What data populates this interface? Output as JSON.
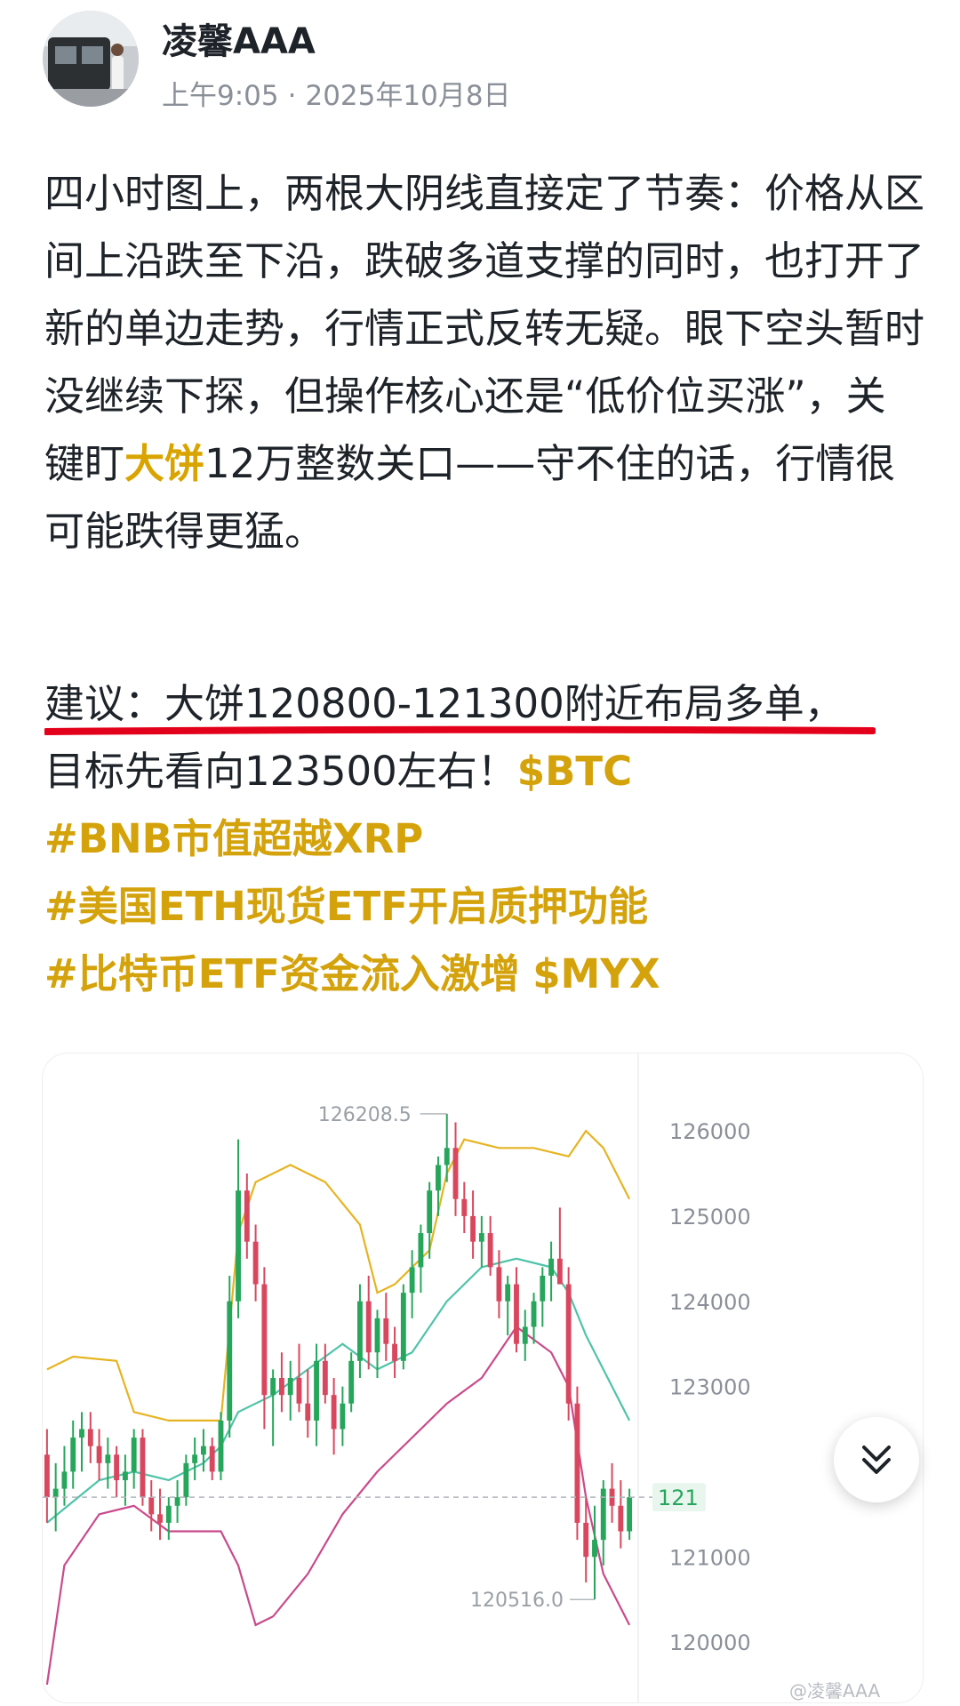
{
  "post": {
    "author": "凌馨AAA",
    "time": "上午9:05",
    "dot": "·",
    "date": "2025年10月8日",
    "para1_a": "四小时图上，两根大阴线直接定了节奏：价格从区间上沿跌至下沿，跌破多道支撑的同时，也打开了新的单边走势，行情正式反转无疑。眼下空头暂时没继续下探，但操作核心还是“低价位买涨”，关键盯",
    "para1_hl": "大饼",
    "para1_b": "12万整数关口——守不住的话，行情很可能跌得更猛。",
    "para2_line1": "建议：大饼120800-121300附近布局多单，",
    "para2_line2": "目标先看向123500左右！",
    "tag_btc": "$BTC",
    "tag1": "#BNB市值超越XRP",
    "tag2": "#美国ETH现货ETF开启质押功能",
    "tag3": "#比特币ETF资金流入激增",
    "tag_myx": "$MYX"
  },
  "chart_data": {
    "type": "candlestick",
    "y_axis_ticks": [
      126000,
      125000,
      124000,
      123000,
      121000,
      120000
    ],
    "ylim": [
      119500,
      126700
    ],
    "high_label": "126208.5",
    "low_label": "120516.0",
    "last_price_label": "121",
    "watermark": "@凌馨AAA",
    "series": [
      {
        "role": "upper-band",
        "color": "#e6b422"
      },
      {
        "role": "middle-band",
        "color": "#4fc3a8"
      },
      {
        "role": "lower-band",
        "color": "#c94a8c"
      }
    ],
    "colors": {
      "up": "#26a65b",
      "down": "#d9475e",
      "underline": "#e3001b",
      "tag": "#d4a20b"
    },
    "candles": [
      [
        122200,
        122500,
        121400,
        121700
      ],
      [
        121700,
        122100,
        121300,
        121800
      ],
      [
        121800,
        122300,
        121600,
        122000
      ],
      [
        122000,
        122600,
        121800,
        122400
      ],
      [
        122400,
        122700,
        122000,
        122500
      ],
      [
        122500,
        122700,
        122100,
        122300
      ],
      [
        122300,
        122500,
        121900,
        122100
      ],
      [
        122100,
        122400,
        121800,
        122200
      ],
      [
        122200,
        122300,
        121700,
        121900
      ],
      [
        121900,
        122200,
        121600,
        122000
      ],
      [
        122000,
        122500,
        121800,
        122400
      ],
      [
        122400,
        122500,
        121600,
        121700
      ],
      [
        121700,
        121900,
        121300,
        121500
      ],
      [
        121500,
        121800,
        121200,
        121400
      ],
      [
        121400,
        121700,
        121200,
        121600
      ],
      [
        121600,
        121900,
        121400,
        121700
      ],
      [
        121700,
        122200,
        121600,
        122100
      ],
      [
        122100,
        122400,
        121900,
        122200
      ],
      [
        122200,
        122500,
        122000,
        122300
      ],
      [
        122300,
        122400,
        121900,
        122000
      ],
      [
        122000,
        122700,
        121900,
        122600
      ],
      [
        122600,
        124300,
        122400,
        124000
      ],
      [
        124000,
        125900,
        123800,
        125300
      ],
      [
        125300,
        125500,
        124500,
        124700
      ],
      [
        124700,
        124900,
        124000,
        124200
      ],
      [
        124200,
        124400,
        122500,
        122900
      ],
      [
        122900,
        123200,
        122300,
        123100
      ],
      [
        123100,
        123400,
        122700,
        122900
      ],
      [
        122900,
        123300,
        122600,
        123100
      ],
      [
        123100,
        123500,
        122700,
        122800
      ],
      [
        122800,
        123200,
        122400,
        122600
      ],
      [
        122600,
        123500,
        122300,
        123300
      ],
      [
        123300,
        123500,
        122800,
        122900
      ],
      [
        122900,
        123100,
        122200,
        122500
      ],
      [
        122500,
        123000,
        122300,
        122800
      ],
      [
        122800,
        123400,
        122700,
        123300
      ],
      [
        123300,
        124200,
        123100,
        124000
      ],
      [
        124000,
        124300,
        123200,
        123400
      ],
      [
        123400,
        123900,
        123100,
        123800
      ],
      [
        123800,
        124100,
        123300,
        123500
      ],
      [
        123500,
        123700,
        123100,
        123300
      ],
      [
        123300,
        124200,
        123200,
        124100
      ],
      [
        124100,
        124600,
        123800,
        124400
      ],
      [
        124400,
        124900,
        124100,
        124800
      ],
      [
        124800,
        125400,
        124500,
        125300
      ],
      [
        125300,
        125700,
        125000,
        125600
      ],
      [
        125600,
        126200,
        125400,
        125800
      ],
      [
        125800,
        126100,
        125000,
        125200
      ],
      [
        125200,
        125400,
        124800,
        125000
      ],
      [
        125000,
        125300,
        124500,
        124700
      ],
      [
        124700,
        125000,
        124400,
        124800
      ],
      [
        124800,
        125000,
        124300,
        124400
      ],
      [
        124400,
        124600,
        123800,
        124000
      ],
      [
        124000,
        124300,
        123600,
        124200
      ],
      [
        124200,
        124400,
        123400,
        123500
      ],
      [
        123500,
        123900,
        123300,
        123700
      ],
      [
        123700,
        124100,
        123500,
        124000
      ],
      [
        124000,
        124400,
        123700,
        124300
      ],
      [
        124300,
        124700,
        124000,
        124500
      ],
      [
        124500,
        125100,
        124300,
        124200
      ],
      [
        124200,
        124400,
        122600,
        122800
      ],
      [
        122800,
        123000,
        121200,
        121400
      ],
      [
        121400,
        121700,
        120700,
        121000
      ],
      [
        121000,
        121600,
        120500,
        121200
      ],
      [
        121200,
        121900,
        120900,
        121800
      ],
      [
        121800,
        122100,
        121400,
        121600
      ],
      [
        121600,
        121900,
        121100,
        121300
      ],
      [
        121300,
        121800,
        121200,
        121700
      ]
    ],
    "upper_band": [
      [
        0,
        123200
      ],
      [
        3,
        123350
      ],
      [
        8,
        123300
      ],
      [
        10,
        122700
      ],
      [
        14,
        122600
      ],
      [
        20,
        122600
      ],
      [
        22,
        124800
      ],
      [
        24,
        125400
      ],
      [
        28,
        125600
      ],
      [
        32,
        125400
      ],
      [
        36,
        124900
      ],
      [
        38,
        124100
      ],
      [
        40,
        124200
      ],
      [
        44,
        124600
      ],
      [
        46,
        125500
      ],
      [
        48,
        125900
      ],
      [
        52,
        125800
      ],
      [
        56,
        125800
      ],
      [
        60,
        125700
      ],
      [
        62,
        126000
      ],
      [
        64,
        125800
      ],
      [
        67,
        125200
      ]
    ],
    "middle_band": [
      [
        0,
        121400
      ],
      [
        6,
        121900
      ],
      [
        10,
        122000
      ],
      [
        14,
        121900
      ],
      [
        18,
        122100
      ],
      [
        20,
        122300
      ],
      [
        22,
        122700
      ],
      [
        26,
        122900
      ],
      [
        30,
        123200
      ],
      [
        34,
        123500
      ],
      [
        38,
        123200
      ],
      [
        42,
        123400
      ],
      [
        46,
        124000
      ],
      [
        50,
        124400
      ],
      [
        54,
        124500
      ],
      [
        58,
        124400
      ],
      [
        60,
        124100
      ],
      [
        62,
        123600
      ],
      [
        67,
        122600
      ]
    ],
    "lower_band": [
      [
        0,
        119500
      ],
      [
        2,
        120900
      ],
      [
        6,
        121500
      ],
      [
        10,
        121600
      ],
      [
        14,
        121300
      ],
      [
        18,
        121300
      ],
      [
        20,
        121300
      ],
      [
        22,
        120900
      ],
      [
        24,
        120200
      ],
      [
        26,
        120300
      ],
      [
        30,
        120800
      ],
      [
        34,
        121500
      ],
      [
        38,
        122000
      ],
      [
        42,
        122400
      ],
      [
        46,
        122800
      ],
      [
        50,
        123100
      ],
      [
        54,
        123700
      ],
      [
        58,
        123400
      ],
      [
        60,
        123000
      ],
      [
        62,
        121700
      ],
      [
        64,
        120800
      ],
      [
        67,
        120200
      ]
    ]
  },
  "ui": {
    "scroll_icon": "double-chevron-down-icon"
  }
}
